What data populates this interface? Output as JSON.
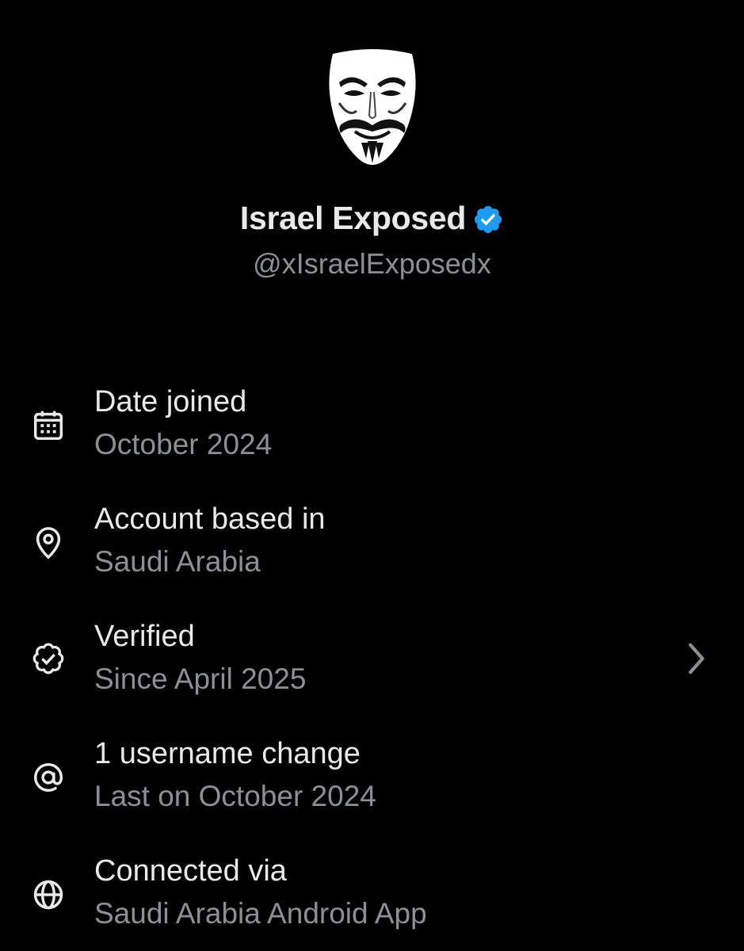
{
  "profile": {
    "display_name": "Israel Exposed",
    "handle": "@xIsraelExposedx",
    "avatar_icon": "mask-icon",
    "badge_color": "#1d9bf0"
  },
  "about": {
    "rows": [
      {
        "icon": "calendar-icon",
        "title": "Date joined",
        "subtitle": "October 2024"
      },
      {
        "icon": "location-pin-icon",
        "title": "Account based in",
        "subtitle": "Saudi Arabia"
      },
      {
        "icon": "verified-badge-icon",
        "title": "Verified",
        "subtitle": "Since April 2025",
        "has_chevron": true
      },
      {
        "icon": "at-sign-icon",
        "title": "1 username change",
        "subtitle": "Last on October 2024"
      },
      {
        "icon": "globe-icon",
        "title": "Connected via",
        "subtitle": "Saudi Arabia Android App"
      }
    ]
  },
  "colors": {
    "background": "#000000",
    "primary_text": "#e7e9ea",
    "secondary_text": "#8b9096",
    "accent": "#1d9bf0"
  }
}
